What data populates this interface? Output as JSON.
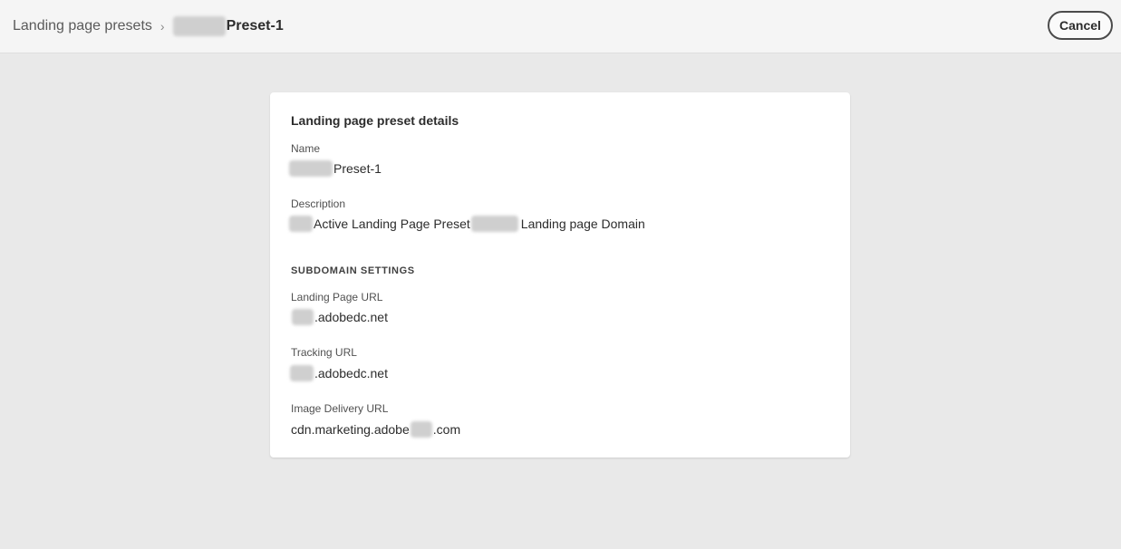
{
  "header": {
    "breadcrumb_root": "Landing page presets",
    "breadcrumb_separator": "›",
    "breadcrumb_current": "Preset-1",
    "cancel_label": "Cancel"
  },
  "card": {
    "title": "Landing page preset details",
    "name_label": "Name",
    "name_value": "Preset-1",
    "description_label": "Description",
    "description_part1": "Active Landing Page Preset",
    "description_part2": "Landing page Domain",
    "section_heading": "SUBDOMAIN SETTINGS",
    "landing_url_label": "Landing Page URL",
    "landing_url_value": ".adobedc.net",
    "tracking_url_label": "Tracking URL",
    "tracking_url_value": ".adobedc.net",
    "image_url_label": "Image Delivery URL",
    "image_url_prefix": "cdn.marketing.adobe",
    "image_url_suffix": ".com"
  }
}
